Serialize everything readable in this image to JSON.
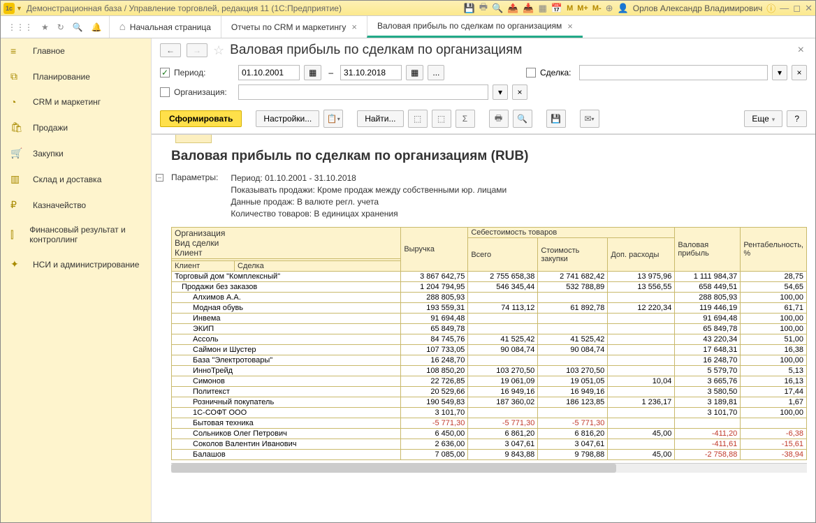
{
  "titlebar": {
    "title": "Демонстрационная база / Управление торговлей, редакция 11  (1С:Предприятие)",
    "user": "Орлов Александр Владимирович",
    "m1": "M",
    "m2": "M+",
    "m3": "M-"
  },
  "tabs": {
    "home": "Начальная страница",
    "t1": "Отчеты по CRM и маркетингу",
    "t2": "Валовая прибыль по сделкам по организациям"
  },
  "sidebar": [
    {
      "icon": "≡",
      "label": "Главное"
    },
    {
      "icon": "⧉",
      "label": "Планирование"
    },
    {
      "icon": "◔",
      "label": "CRM и маркетинг"
    },
    {
      "icon": "🛍",
      "label": "Продажи"
    },
    {
      "icon": "🛒",
      "label": "Закупки"
    },
    {
      "icon": "▥",
      "label": "Склад и доставка"
    },
    {
      "icon": "₽",
      "label": "Казначейство"
    },
    {
      "icon": "⫿",
      "label": "Финансовый результат и контроллинг"
    },
    {
      "icon": "✦",
      "label": "НСИ и администрирование"
    }
  ],
  "page": {
    "title": "Валовая прибыль по сделкам по организациям",
    "period_label": "Период:",
    "date_from": "01.10.2001",
    "date_to": "31.10.2018",
    "dash": "–",
    "ellipsis": "...",
    "deal_label": "Сделка:",
    "org_label": "Организация:"
  },
  "toolbar": {
    "form": "Сформировать",
    "settings": "Настройки...",
    "find": "Найти...",
    "more": "Еще",
    "help": "?"
  },
  "report": {
    "title": "Валовая прибыль по сделкам по организациям (RUB)",
    "params_label": "Параметры:",
    "params": [
      "Период: 01.10.2001 - 31.10.2018",
      "Показывать продажи: Кроме продаж между собственными юр. лицами",
      "Данные продаж: В валюте регл. учета",
      "Количество товаров: В единицах хранения"
    ],
    "headers": {
      "org": "Организация",
      "deal_type": "Вид сделки",
      "client": "Клиент",
      "client2": "Клиент",
      "deal": "Сделка",
      "revenue": "Выручка",
      "cost": "Себестоимость товаров",
      "total": "Всего",
      "purchase": "Стоимость закупки",
      "extra": "Доп. расходы",
      "gross": "Валовая прибыль",
      "rent": "Рентабельность, %"
    },
    "rows": [
      {
        "i": 0,
        "name": "Торговый дом \"Комплексный\"",
        "rev": "3 867 642,75",
        "tot": "2 755 658,38",
        "pur": "2 741 682,42",
        "ext": "13 975,96",
        "gp": "1 111 984,37",
        "r": "28,75"
      },
      {
        "i": 1,
        "name": "Продажи без заказов",
        "rev": "1 204 794,95",
        "tot": "546 345,44",
        "pur": "532 788,89",
        "ext": "13 556,55",
        "gp": "658 449,51",
        "r": "54,65"
      },
      {
        "i": 2,
        "name": "Алхимов А.А.",
        "rev": "288 805,93",
        "tot": "",
        "pur": "",
        "ext": "",
        "gp": "288 805,93",
        "r": "100,00"
      },
      {
        "i": 2,
        "name": "Модная обувь",
        "rev": "193 559,31",
        "tot": "74 113,12",
        "pur": "61 892,78",
        "ext": "12 220,34",
        "gp": "119 446,19",
        "r": "61,71"
      },
      {
        "i": 2,
        "name": "Инвема",
        "rev": "91 694,48",
        "tot": "",
        "pur": "",
        "ext": "",
        "gp": "91 694,48",
        "r": "100,00"
      },
      {
        "i": 2,
        "name": "ЭКИП",
        "rev": "65 849,78",
        "tot": "",
        "pur": "",
        "ext": "",
        "gp": "65 849,78",
        "r": "100,00"
      },
      {
        "i": 2,
        "name": "Ассоль",
        "rev": "84 745,76",
        "tot": "41 525,42",
        "pur": "41 525,42",
        "ext": "",
        "gp": "43 220,34",
        "r": "51,00"
      },
      {
        "i": 2,
        "name": "Саймон и Шустер",
        "rev": "107 733,05",
        "tot": "90 084,74",
        "pur": "90 084,74",
        "ext": "",
        "gp": "17 648,31",
        "r": "16,38"
      },
      {
        "i": 2,
        "name": "База \"Электротовары\"",
        "rev": "16 248,70",
        "tot": "",
        "pur": "",
        "ext": "",
        "gp": "16 248,70",
        "r": "100,00"
      },
      {
        "i": 2,
        "name": "ИнноТрейд",
        "rev": "108 850,20",
        "tot": "103 270,50",
        "pur": "103 270,50",
        "ext": "",
        "gp": "5 579,70",
        "r": "5,13"
      },
      {
        "i": 2,
        "name": "Симонов",
        "rev": "22 726,85",
        "tot": "19 061,09",
        "pur": "19 051,05",
        "ext": "10,04",
        "gp": "3 665,76",
        "r": "16,13"
      },
      {
        "i": 2,
        "name": "Политекст",
        "rev": "20 529,66",
        "tot": "16 949,16",
        "pur": "16 949,16",
        "ext": "",
        "gp": "3 580,50",
        "r": "17,44"
      },
      {
        "i": 2,
        "name": "Розничный покупатель",
        "rev": "190 549,83",
        "tot": "187 360,02",
        "pur": "186 123,85",
        "ext": "1 236,17",
        "gp": "3 189,81",
        "r": "1,67"
      },
      {
        "i": 2,
        "name": "1С-СОФТ ООО",
        "rev": "3 101,70",
        "tot": "",
        "pur": "",
        "ext": "",
        "gp": "3 101,70",
        "r": "100,00"
      },
      {
        "i": 2,
        "name": "Бытовая техника",
        "rev": "-5 771,30",
        "tot": "-5 771,30",
        "pur": "-5 771,30",
        "ext": "",
        "gp": "",
        "r": "",
        "neg": true
      },
      {
        "i": 2,
        "name": "Сольников Олег Петрович",
        "rev": "6 450,00",
        "tot": "6 861,20",
        "pur": "6 816,20",
        "ext": "45,00",
        "gp": "-411,20",
        "r": "-6,38",
        "neggp": true
      },
      {
        "i": 2,
        "name": "Соколов Валентин Иванович",
        "rev": "2 636,00",
        "tot": "3 047,61",
        "pur": "3 047,61",
        "ext": "",
        "gp": "-411,61",
        "r": "-15,61",
        "neggp": true
      },
      {
        "i": 2,
        "name": "Балашов",
        "rev": "7 085,00",
        "tot": "9 843,88",
        "pur": "9 798,88",
        "ext": "45,00",
        "gp": "-2 758,88",
        "r": "-38,94",
        "neggp": true
      }
    ]
  }
}
